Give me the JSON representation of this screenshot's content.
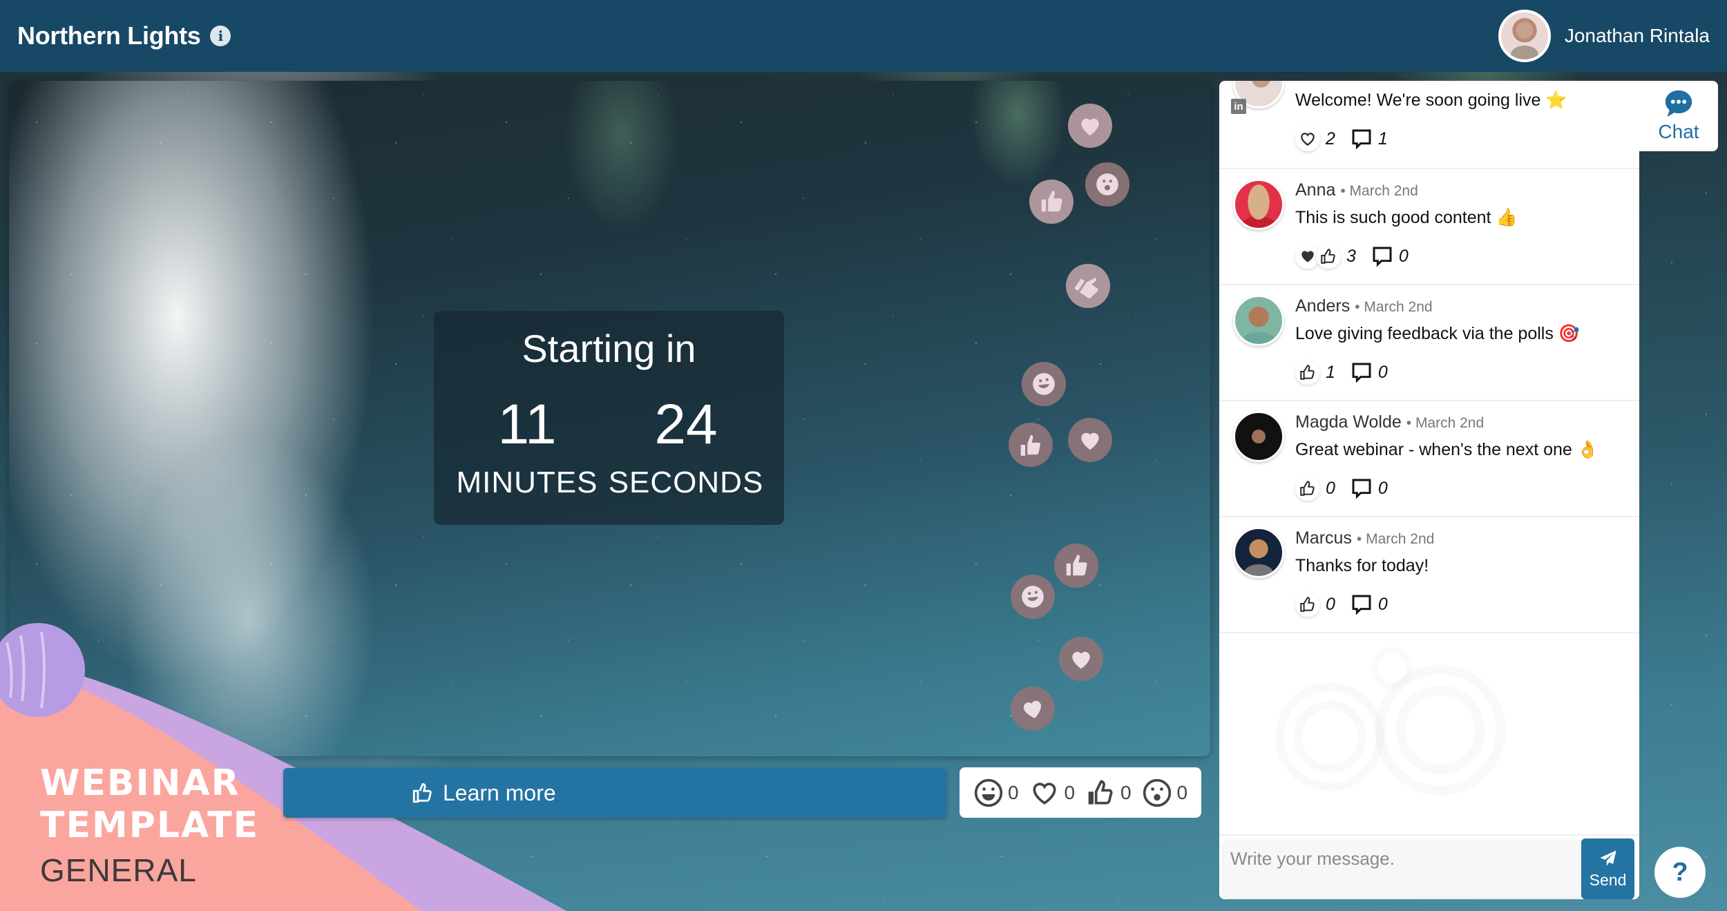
{
  "header": {
    "title": "Northern Lights",
    "info_icon": "info-icon",
    "user": {
      "name": "Jonathan Rintala",
      "avatar": "user-avatar"
    }
  },
  "countdown": {
    "title": "Starting in",
    "minutes": "11",
    "minutes_label": "MINUTES",
    "seconds": "24",
    "seconds_label": "SECONDS"
  },
  "floating_reactions": [
    "heart",
    "thumbs-up",
    "surprised",
    "thumbs-up",
    "laugh",
    "thumbs-up",
    "heart",
    "thumbs-up",
    "laugh",
    "heart",
    "heart"
  ],
  "learn_more": {
    "label": "Learn more",
    "icon": "thumbs-up-icon"
  },
  "reactions_bar": [
    {
      "name": "laugh",
      "count": "0"
    },
    {
      "name": "heart",
      "count": "0"
    },
    {
      "name": "thumbs-up",
      "count": "0"
    },
    {
      "name": "surprised",
      "count": "0"
    }
  ],
  "branding": {
    "line1": "WEBINAR",
    "line2": "TEMPLATE",
    "line3": "GENERAL"
  },
  "chat": {
    "tab_label": "Chat",
    "messages": [
      {
        "author": "",
        "date": "",
        "text": "Welcome! We're soon going live ⭐",
        "likes": "2",
        "like_icon": "heart",
        "comments": "1",
        "linkedin": true
      },
      {
        "author": "Anna",
        "date": "March 2nd",
        "text": "This is such good content 👍",
        "likes": "3",
        "like_icon": "heart+thumbs-up",
        "comments": "0"
      },
      {
        "author": "Anders",
        "date": "March 2nd",
        "text": "Love giving feedback via the polls 🎯",
        "likes": "1",
        "like_icon": "thumbs-up",
        "comments": "0"
      },
      {
        "author": "Magda Wolde",
        "date": "March 2nd",
        "text": "Great webinar - when's the next one 👌",
        "likes": "0",
        "like_icon": "thumbs-up",
        "comments": "0"
      },
      {
        "author": "Marcus",
        "date": "March 2nd",
        "text": "Thanks for today!",
        "likes": "0",
        "like_icon": "thumbs-up",
        "comments": "0"
      }
    ],
    "input_placeholder": "Write your message.",
    "send_label": "Send"
  },
  "help_label": "?",
  "colors": {
    "header": "#174865",
    "accent": "#2474a3",
    "chat_accent": "#1f6fa0",
    "brand_pink": "#f9a5a0",
    "brand_lilac": "#c8a8e0"
  }
}
